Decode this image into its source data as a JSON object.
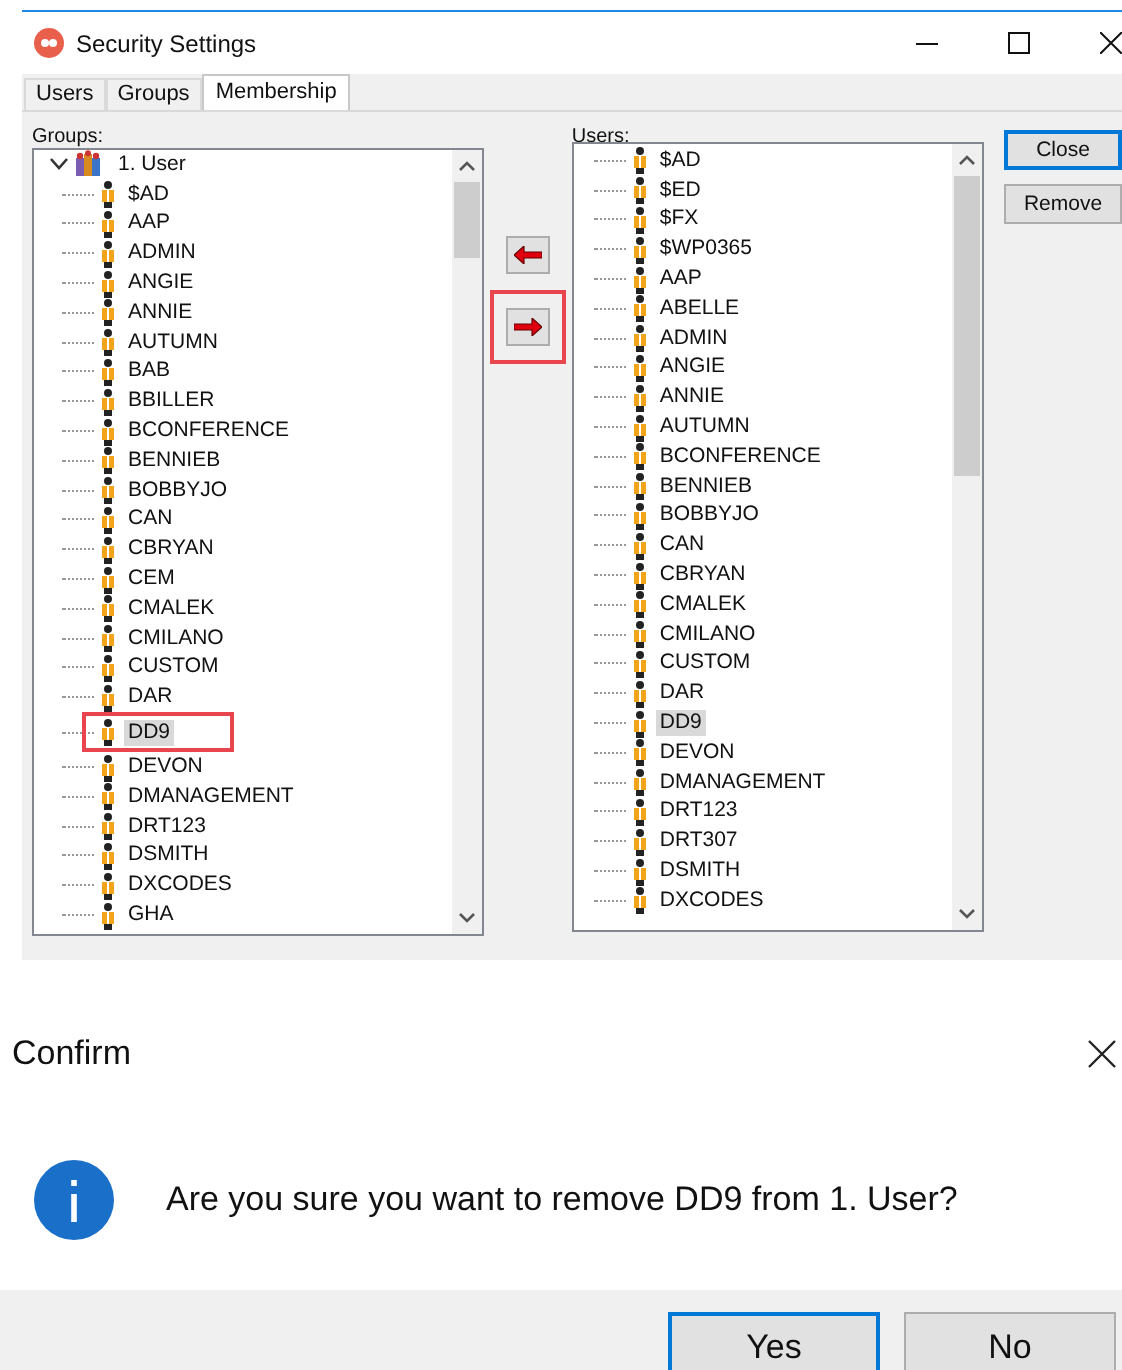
{
  "window": {
    "title": "Security Settings"
  },
  "tabs": [
    {
      "label": "Users",
      "selected": false
    },
    {
      "label": "Groups",
      "selected": false
    },
    {
      "label": "Membership",
      "selected": true
    }
  ],
  "groups": {
    "label": "Groups:",
    "root": {
      "label": "1. User",
      "expanded": true,
      "children": [
        {
          "label": "$AD",
          "selected": false
        },
        {
          "label": "AAP",
          "selected": false
        },
        {
          "label": "ADMIN",
          "selected": false
        },
        {
          "label": "ANGIE",
          "selected": false
        },
        {
          "label": "ANNIE",
          "selected": false
        },
        {
          "label": "AUTUMN",
          "selected": false
        },
        {
          "label": "BAB",
          "selected": false
        },
        {
          "label": "BBILLER",
          "selected": false
        },
        {
          "label": "BCONFERENCE",
          "selected": false
        },
        {
          "label": "BENNIEB",
          "selected": false
        },
        {
          "label": "BOBBYJO",
          "selected": false
        },
        {
          "label": "CAN",
          "selected": false
        },
        {
          "label": "CBRYAN",
          "selected": false
        },
        {
          "label": "CEM",
          "selected": false
        },
        {
          "label": "CMALEK",
          "selected": false
        },
        {
          "label": "CMILANO",
          "selected": false
        },
        {
          "label": "CUSTOM",
          "selected": false
        },
        {
          "label": "DAR",
          "selected": false
        },
        {
          "label": "DD9",
          "selected": true
        },
        {
          "label": "DEVON",
          "selected": false
        },
        {
          "label": "DMANAGEMENT",
          "selected": false
        },
        {
          "label": "DRT123",
          "selected": false
        },
        {
          "label": "DSMITH",
          "selected": false
        },
        {
          "label": "DXCODES",
          "selected": false
        },
        {
          "label": "GHA",
          "selected": false
        }
      ]
    }
  },
  "users": {
    "label": "Users:",
    "items": [
      {
        "label": "$AD",
        "selected": false
      },
      {
        "label": "$ED",
        "selected": false
      },
      {
        "label": "$FX",
        "selected": false
      },
      {
        "label": "$WP0365",
        "selected": false
      },
      {
        "label": "AAP",
        "selected": false
      },
      {
        "label": "ABELLE",
        "selected": false
      },
      {
        "label": "ADMIN",
        "selected": false
      },
      {
        "label": "ANGIE",
        "selected": false
      },
      {
        "label": "ANNIE",
        "selected": false
      },
      {
        "label": "AUTUMN",
        "selected": false
      },
      {
        "label": "BCONFERENCE",
        "selected": false
      },
      {
        "label": "BENNIEB",
        "selected": false
      },
      {
        "label": "BOBBYJO",
        "selected": false
      },
      {
        "label": "CAN",
        "selected": false
      },
      {
        "label": "CBRYAN",
        "selected": false
      },
      {
        "label": "CMALEK",
        "selected": false
      },
      {
        "label": "CMILANO",
        "selected": false
      },
      {
        "label": "CUSTOM",
        "selected": false
      },
      {
        "label": "DAR",
        "selected": false
      },
      {
        "label": "DD9",
        "selected": true
      },
      {
        "label": "DEVON",
        "selected": false
      },
      {
        "label": "DMANAGEMENT",
        "selected": false
      },
      {
        "label": "DRT123",
        "selected": false
      },
      {
        "label": "DRT307",
        "selected": false
      },
      {
        "label": "DSMITH",
        "selected": false
      },
      {
        "label": "DXCODES",
        "selected": false
      }
    ]
  },
  "side_buttons": [
    "Close",
    "Remove"
  ],
  "confirm": {
    "title": "Confirm",
    "message": "Are you sure you want to remove DD9 from 1. User?",
    "buttons": [
      {
        "label": "Yes",
        "selected": true
      },
      {
        "label": "No",
        "selected": false
      }
    ]
  }
}
